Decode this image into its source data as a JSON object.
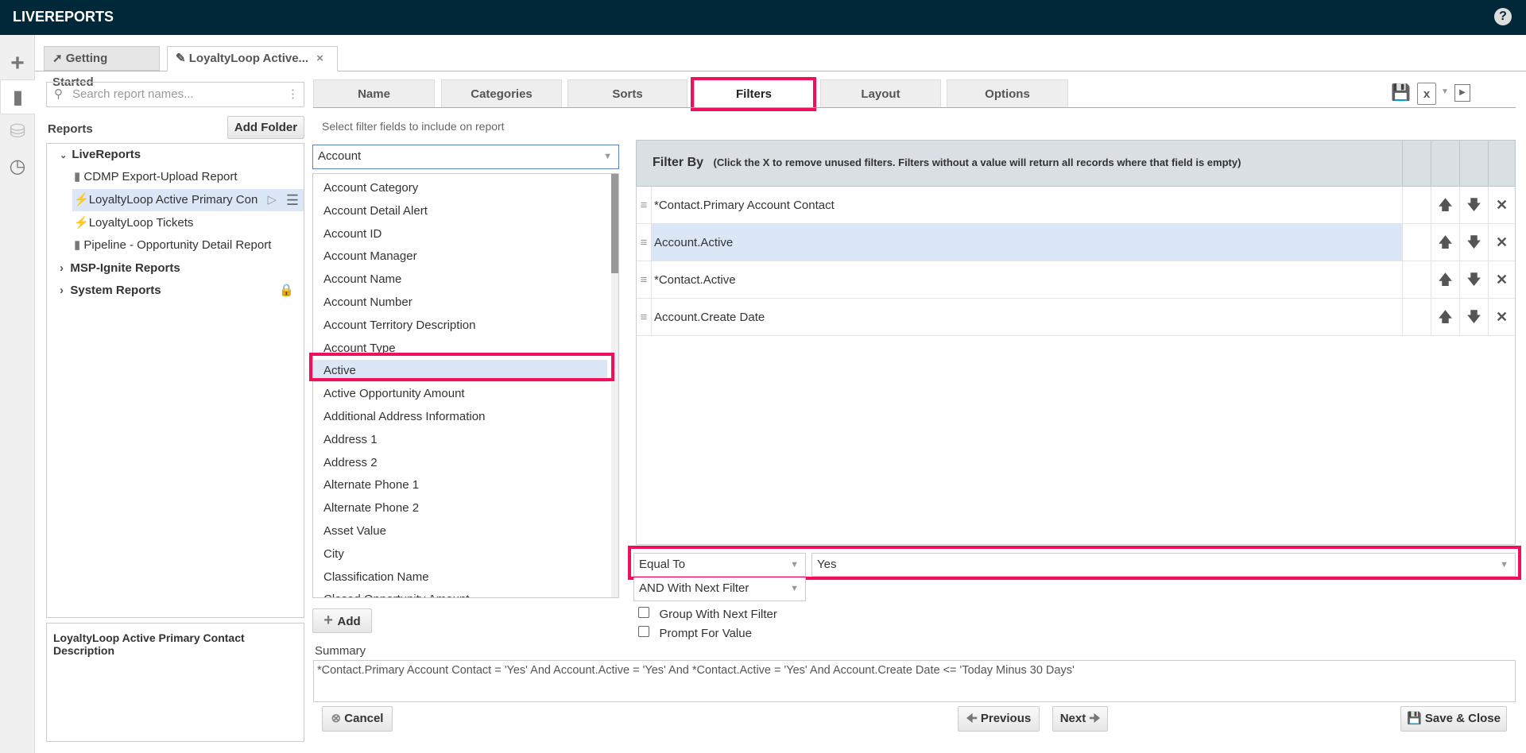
{
  "app": {
    "title": "LIVEREPORTS",
    "help_icon": "question-circle-icon"
  },
  "rail": {
    "icons": [
      "plus-icon",
      "document-icon",
      "database-icon",
      "clock-icon"
    ]
  },
  "doc_tabs": [
    {
      "label": "Getting Started",
      "icon": "arrow-circle-icon"
    },
    {
      "label": "LoyaltyLoop Active...",
      "icon": "pencil-icon",
      "close": "×"
    }
  ],
  "sidebar": {
    "search_placeholder": "Search report names...",
    "reports_label": "Reports",
    "add_folder": "Add Folder",
    "tree": [
      {
        "label": "LiveReports",
        "level": 0,
        "expanded": true
      },
      {
        "label": "CDMP Export-Upload Report",
        "level": 1,
        "icon": "notebook-icon"
      },
      {
        "label": "LoyaltyLoop Active Primary Con",
        "level": 1,
        "icon": "lightning-icon",
        "selected": true
      },
      {
        "label": "LoyaltyLoop Tickets",
        "level": 1,
        "icon": "lightning-icon"
      },
      {
        "label": "Pipeline - Opportunity Detail Report",
        "level": 1,
        "icon": "notebook-icon"
      },
      {
        "label": "MSP-Ignite Reports",
        "level": 0,
        "expanded": false
      },
      {
        "label": "System Reports",
        "level": 0,
        "expanded": false,
        "locked": true
      }
    ],
    "description": "LoyaltyLoop Active Primary Contact Description"
  },
  "wizard": {
    "tabs": [
      "Name",
      "Categories",
      "Sorts",
      "Filters",
      "Layout",
      "Options"
    ],
    "active_tab": "Filters",
    "instruction": "Select filter fields to include on report",
    "entity_select": "Account",
    "fields": [
      "Account Category",
      "Account Detail Alert",
      "Account ID",
      "Account Manager",
      "Account Name",
      "Account Number",
      "Account Territory Description",
      "Account Type",
      "Active",
      "Active Opportunity Amount",
      "Additional Address Information",
      "Address 1",
      "Address 2",
      "Alternate Phone 1",
      "Alternate Phone 2",
      "Asset Value",
      "City",
      "Classification Name",
      "Closed Opportunity Amount"
    ],
    "selected_field": "Active",
    "add_button": "Add",
    "filter_header": "Filter By",
    "filter_hint": "(Click the X to remove unused filters. Filters without a value will return all records where that field is empty)",
    "filters": [
      "*Contact.Primary Account Contact",
      "Account.Active",
      "*Contact.Active",
      "Account.Create Date"
    ],
    "selected_filter": 1,
    "operator": "Equal To",
    "value": "Yes",
    "conjunction": "AND With Next Filter",
    "group_label": "Group With Next Filter",
    "prompt_label": "Prompt For Value",
    "summary_label": "Summary",
    "summary": "*Contact.Primary Account Contact = 'Yes' And Account.Active = 'Yes' And *Contact.Active = 'Yes' And Account.Create Date <= 'Today Minus 30 Days'",
    "cancel": "Cancel",
    "previous": "Previous",
    "next": "Next",
    "save_close": "Save & Close"
  },
  "colors": {
    "topbar": "#002838",
    "highlight": "#f0105a",
    "selection": "#dbe7f6"
  }
}
